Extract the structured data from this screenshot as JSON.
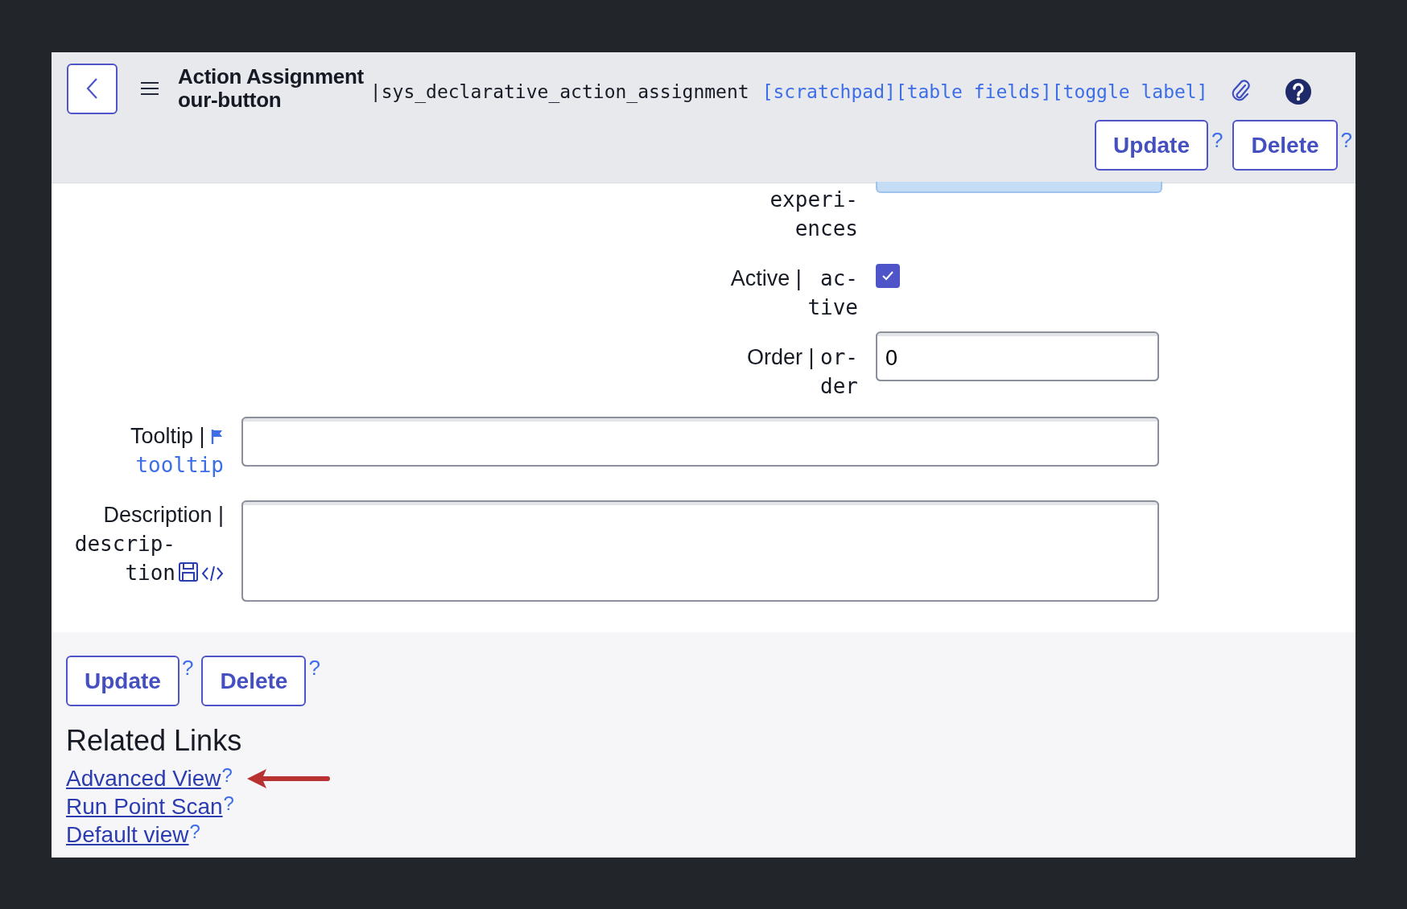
{
  "header": {
    "title": "Action Assignment\nour-button",
    "table": "|sys_declarative_action_assignment",
    "links": [
      "[scratchpad]",
      "[table fields]",
      "[toggle label]"
    ],
    "buttons": [
      {
        "label": "Update",
        "help": "?"
      },
      {
        "label": "Delete",
        "help": "?"
      }
    ]
  },
  "fields": [
    {
      "kind": "cut",
      "name": "experi-\nences"
    },
    {
      "kind": "checkbox",
      "label": "Active |",
      "name": "ac-\ntive",
      "checked": true
    },
    {
      "kind": "input",
      "label": "Order |",
      "name": "or-\nder",
      "value": "0"
    },
    {
      "kind": "input",
      "label": "Tooltip |",
      "name": "tooltip",
      "translated": true
    },
    {
      "kind": "textarea",
      "label": "Description |",
      "name": "descrip-\ntion"
    }
  ],
  "buttons": [
    {
      "label": "Update",
      "help": "?"
    },
    {
      "label": "Delete",
      "help": "?"
    }
  ],
  "related_links": {
    "title": "Related Links",
    "links": [
      {
        "text": "Advanced View",
        "help": "?",
        "pointed": true
      },
      {
        "text": "Run Point Scan",
        "help": "?",
        "pointed": false
      },
      {
        "text": "Default view",
        "help": "?",
        "pointed": false
      }
    ]
  }
}
